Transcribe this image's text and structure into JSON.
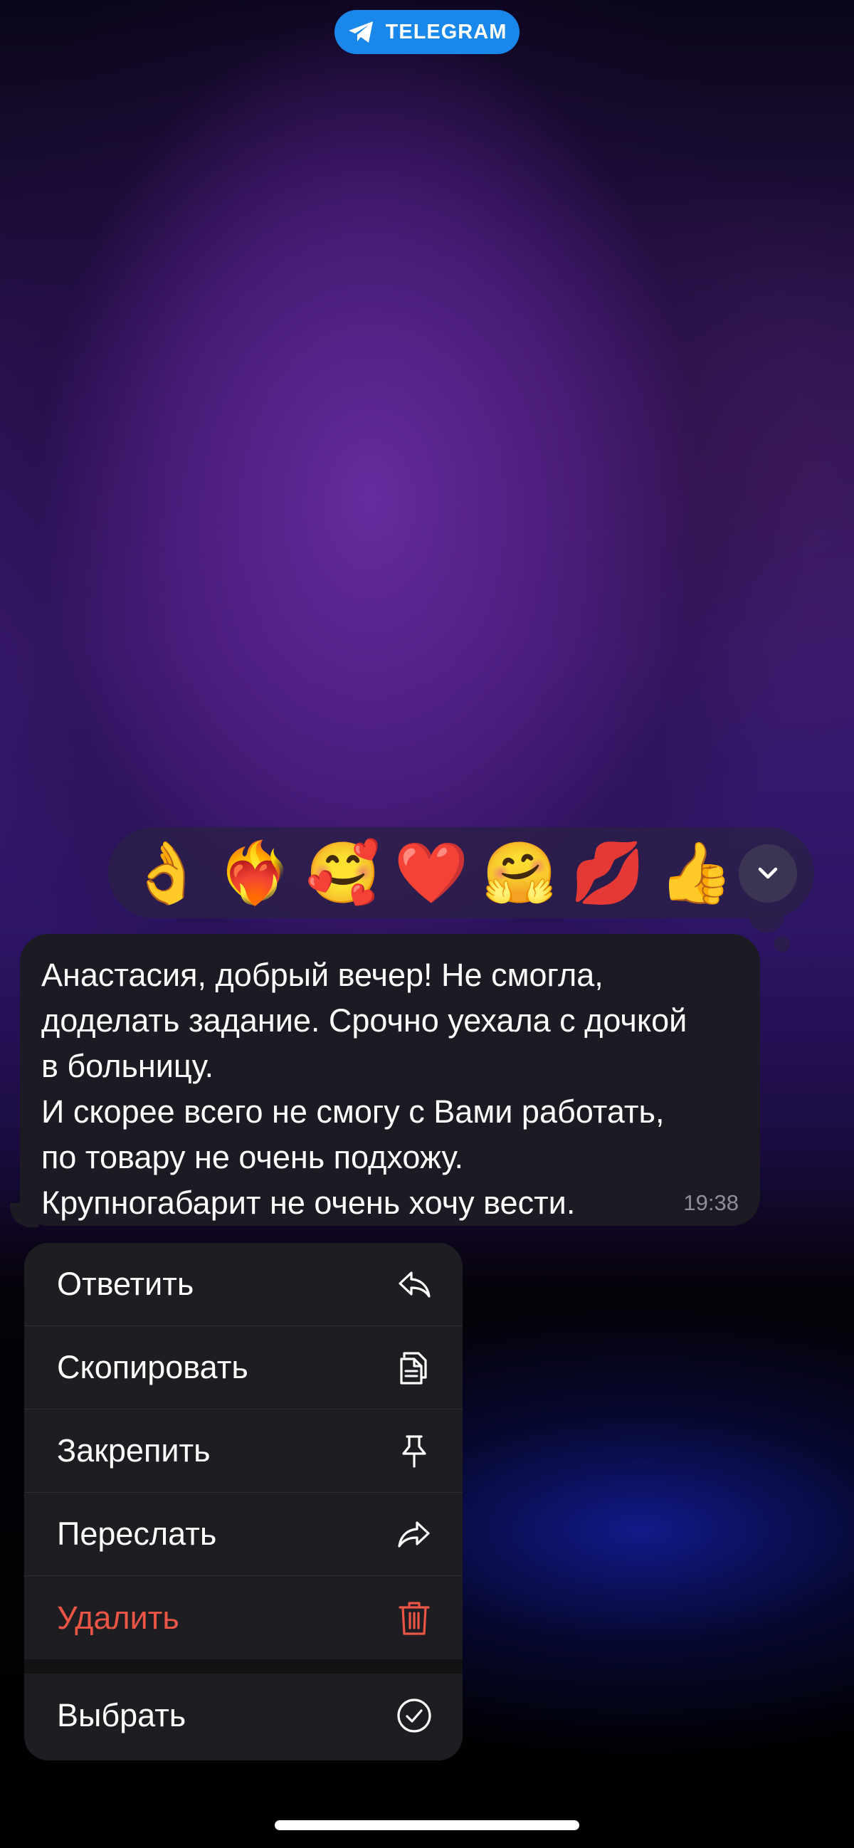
{
  "header": {
    "brand_label": "TELEGRAM",
    "brand_color": "#1a87ea",
    "brand_icon": "telegram-plane-icon"
  },
  "reactions": {
    "items": [
      {
        "emoji": "👌",
        "name": "ok-hand"
      },
      {
        "emoji": "❤️‍🔥",
        "name": "heart-on-fire"
      },
      {
        "emoji": "🥰",
        "name": "smiling-face-with-hearts"
      },
      {
        "emoji": "❤️",
        "name": "red-heart"
      },
      {
        "emoji": "🤗",
        "name": "hugging-face"
      },
      {
        "emoji": "💋",
        "name": "kiss-mark"
      },
      {
        "emoji": "👍",
        "name": "thumbs-up"
      }
    ],
    "expand_icon": "chevron-down-icon"
  },
  "message": {
    "text": "Анастасия, добрый вечер! Не смогла,\nдоделать задание. Срочно уехала с дочкой\nв больницу.\nИ скорее всего не смогу с Вами работать,\nпо товару не очень подхожу.\nКрупногабарит не очень хочу вести.",
    "time": "19:38"
  },
  "context_menu": {
    "reply": {
      "label": "Ответить",
      "icon": "reply-icon"
    },
    "copy": {
      "label": "Скопировать",
      "icon": "copy-icon"
    },
    "pin": {
      "label": "Закрепить",
      "icon": "pin-icon"
    },
    "forward": {
      "label": "Переслать",
      "icon": "forward-icon"
    },
    "delete": {
      "label": "Удалить",
      "icon": "trash-icon",
      "color": "#eb5545"
    },
    "select": {
      "label": "Выбрать",
      "icon": "checkmark-circle-icon"
    }
  }
}
